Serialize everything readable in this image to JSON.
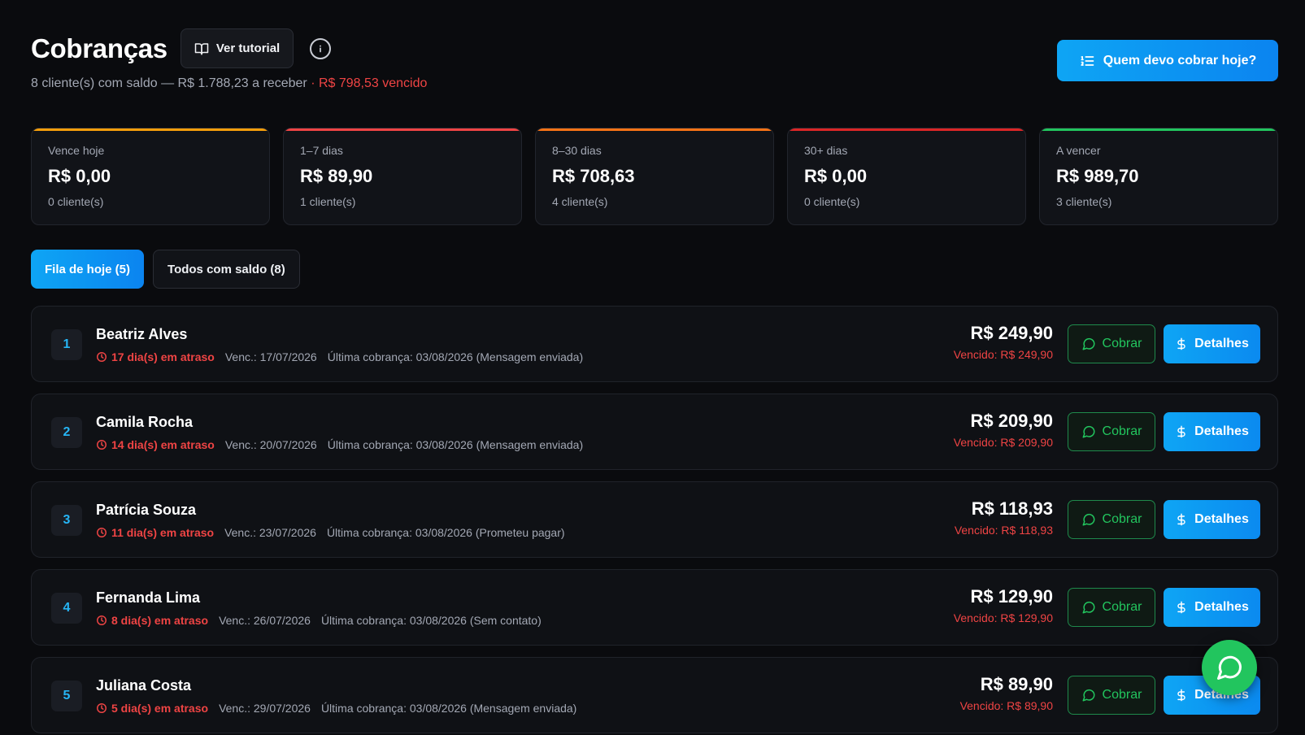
{
  "header": {
    "title": "Cobranças",
    "tutorial_label": "Ver tutorial",
    "subtitle_main": "8 cliente(s) com saldo — R$ 1.788,23 a receber",
    "subtitle_overdue": "· R$ 798,53 vencido",
    "cta_label": "Quem devo cobrar hoje?"
  },
  "cards": [
    {
      "label": "Vence hoje",
      "value": "R$ 0,00",
      "count": "0 cliente(s)",
      "color": "#f59e0b"
    },
    {
      "label": "1–7 dias",
      "value": "R$ 89,90",
      "count": "1 cliente(s)",
      "color": "#ef4444"
    },
    {
      "label": "8–30 dias",
      "value": "R$ 708,63",
      "count": "4 cliente(s)",
      "color": "#f97316"
    },
    {
      "label": "30+ dias",
      "value": "R$ 0,00",
      "count": "0 cliente(s)",
      "color": "#dc2626"
    },
    {
      "label": "A vencer",
      "value": "R$ 989,70",
      "count": "3 cliente(s)",
      "color": "#22c55e"
    }
  ],
  "tabs": [
    {
      "label": "Fila de hoje (5)",
      "active": true
    },
    {
      "label": "Todos com saldo (8)",
      "active": false
    }
  ],
  "queue": [
    {
      "rank": "1",
      "name": "Beatriz Alves",
      "late": "17 dia(s) em atraso",
      "due": "Venc.: 17/07/2026",
      "last": "Última cobrança: 03/08/2026 (Mensagem enviada)",
      "amount": "R$ 249,90",
      "overdue": "Vencido: R$ 249,90"
    },
    {
      "rank": "2",
      "name": "Camila Rocha",
      "late": "14 dia(s) em atraso",
      "due": "Venc.: 20/07/2026",
      "last": "Última cobrança: 03/08/2026 (Mensagem enviada)",
      "amount": "R$ 209,90",
      "overdue": "Vencido: R$ 209,90"
    },
    {
      "rank": "3",
      "name": "Patrícia Souza",
      "late": "11 dia(s) em atraso",
      "due": "Venc.: 23/07/2026",
      "last": "Última cobrança: 03/08/2026 (Prometeu pagar)",
      "amount": "R$ 118,93",
      "overdue": "Vencido: R$ 118,93"
    },
    {
      "rank": "4",
      "name": "Fernanda Lima",
      "late": "8 dia(s) em atraso",
      "due": "Venc.: 26/07/2026",
      "last": "Última cobrança: 03/08/2026 (Sem contato)",
      "amount": "R$ 129,90",
      "overdue": "Vencido: R$ 129,90"
    },
    {
      "rank": "5",
      "name": "Juliana Costa",
      "late": "5 dia(s) em atraso",
      "due": "Venc.: 29/07/2026",
      "last": "Última cobrança: 03/08/2026 (Mensagem enviada)",
      "amount": "R$ 89,90",
      "overdue": "Vencido: R$ 89,90"
    }
  ],
  "actions": {
    "cobrar_label": "Cobrar",
    "detalhes_label": "Detalhes"
  },
  "icons": {
    "tutorial": "book-open-icon",
    "info": "info-icon",
    "cta": "list-ordered-icon",
    "late": "clock-icon",
    "cobrar": "message-circle-icon",
    "detalhes": "dollar-sign-icon",
    "fab": "whatsapp-icon"
  }
}
